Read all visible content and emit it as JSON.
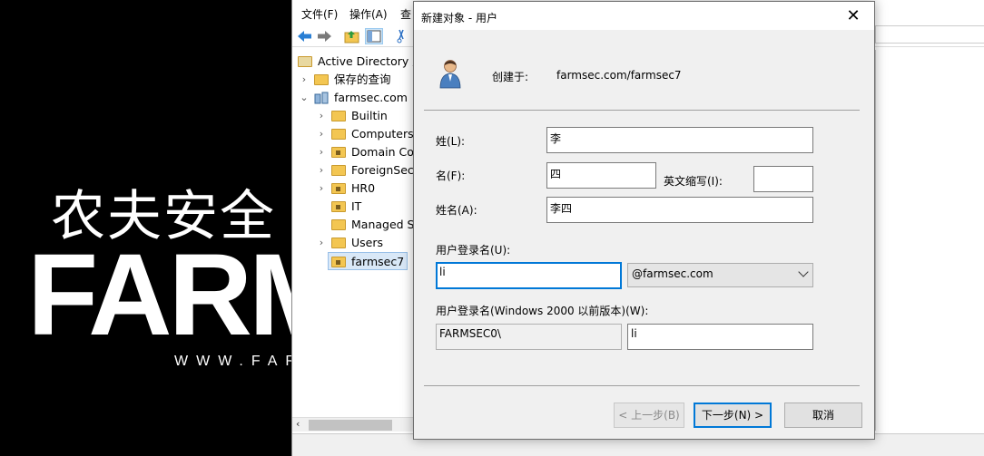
{
  "background": {
    "logo_cn": "农夫安全",
    "logo_en": "FARM",
    "logo_url": "WWW.FAR"
  },
  "mmc": {
    "menu": [
      "文件(F)",
      "操作(A)",
      "查"
    ],
    "tree": {
      "root": "Active Directory 用",
      "saved_queries": "保存的查询",
      "domain": "farmsec.com",
      "children": [
        "Builtin",
        "Computers",
        "Domain Cor",
        "ForeignSecu",
        "HR0",
        "IT",
        "Managed Se",
        "Users",
        "farmsec7"
      ]
    }
  },
  "dialog": {
    "title": "新建对象 - 用户",
    "create_in_label": "创建于:",
    "create_in_value": "farmsec.com/farmsec7",
    "last_name_label": "姓(L):",
    "last_name_value": "李",
    "first_name_label": "名(F):",
    "first_name_value": "四",
    "initials_label": "英文缩写(I):",
    "initials_value": "",
    "full_name_label": "姓名(A):",
    "full_name_value": "李四",
    "logon_name_label": "用户登录名(U):",
    "logon_name_value": "li",
    "upn_suffix": "@farmsec.com",
    "pre2000_label": "用户登录名(Windows 2000 以前版本)(W):",
    "pre2000_domain": "FARMSEC0\\",
    "pre2000_name": "li",
    "back_button": "< 上一步(B)",
    "next_button": "下一步(N) >",
    "cancel_button": "取消"
  }
}
